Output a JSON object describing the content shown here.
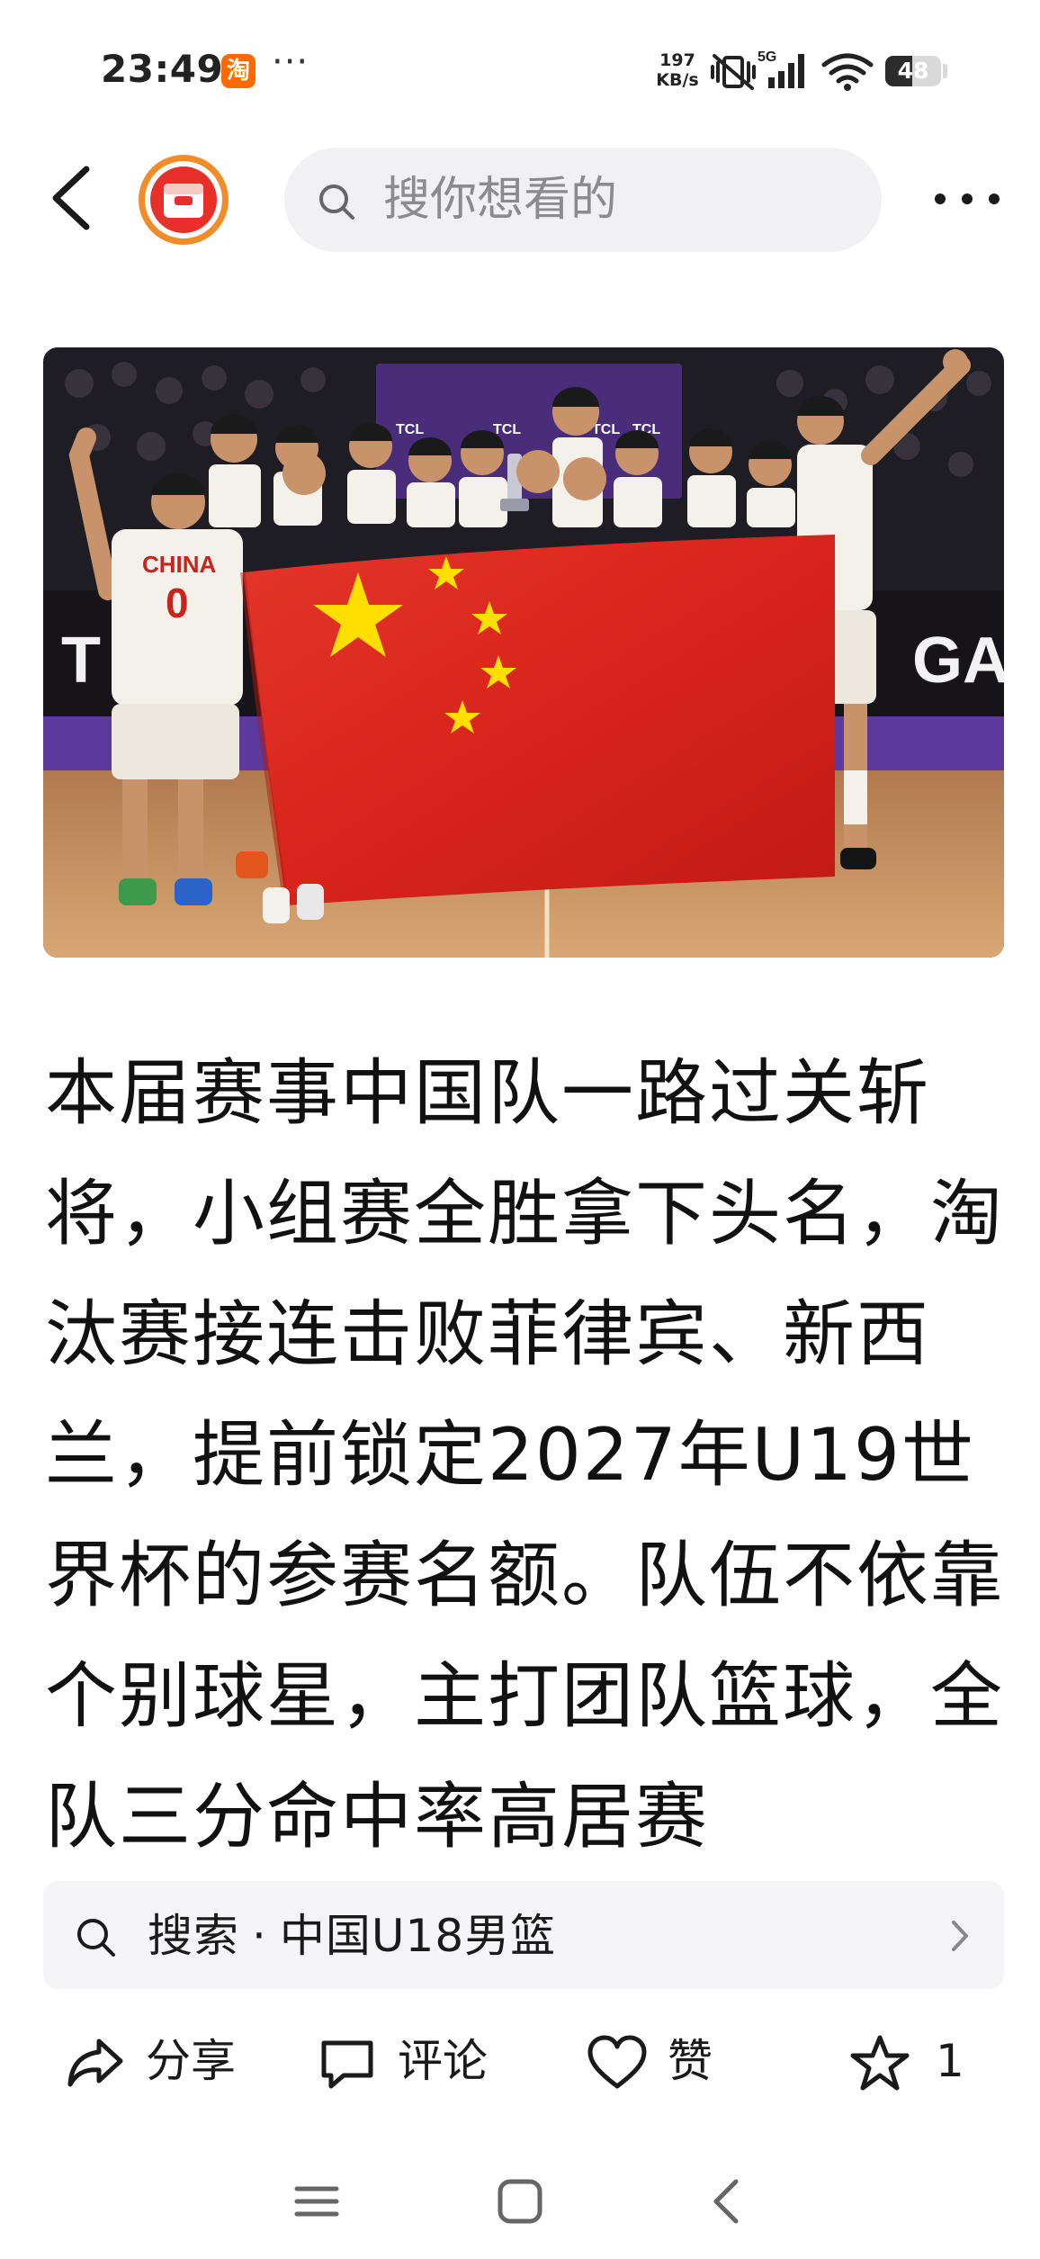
{
  "status_bar": {
    "time": "23:49",
    "app_badge": "淘",
    "more": "···",
    "net_speed_value": "197",
    "net_speed_unit": "KB/s",
    "network": "5G",
    "battery": "48",
    "battery_level": 0.48
  },
  "header": {
    "search_placeholder": "搜你想看的"
  },
  "hero_image": {
    "jersey_text": "CHINA",
    "jersey_number": "0",
    "backdrop_text": "TCL",
    "banner_text": "GAN"
  },
  "article": {
    "text": "本届赛事中国队一路过关斩将，小组赛全胜拿下头名，淘汰赛接连击败菲律宾、新西兰，提前锁定2027年U19世界杯的参赛名额。队伍不依靠个别球星，主打团队篮球，全队三分命中率高居赛"
  },
  "related_search": {
    "prefix": "搜索",
    "separator": "·",
    "query": "中国U18男篮"
  },
  "actions": {
    "share": "分享",
    "comment": "评论",
    "like": "赞",
    "favorite_count": "1"
  },
  "colors": {
    "accent_orange": "#ff6a00",
    "logo_ring": "#f28c28",
    "logo_red": "#e8302a",
    "flag_red": "#d8241c",
    "flag_yellow": "#ffde00",
    "search_bg": "#f1f1f3"
  }
}
